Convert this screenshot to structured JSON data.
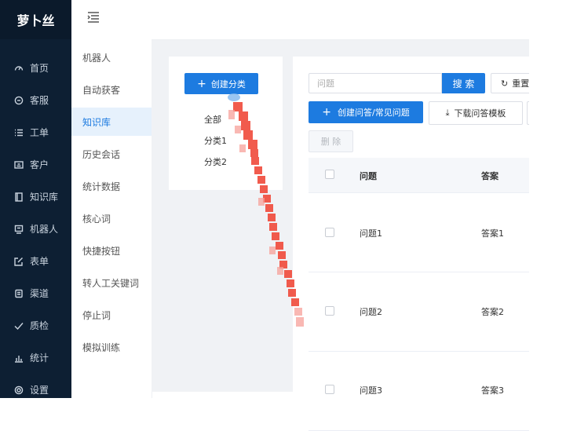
{
  "app": {
    "logo": "萝卜丝"
  },
  "sidebar": {
    "items": [
      {
        "label": "首页",
        "icon": "dashboard-icon"
      },
      {
        "label": "客服",
        "icon": "headset-icon"
      },
      {
        "label": "工单",
        "icon": "list-icon"
      },
      {
        "label": "客户",
        "icon": "contact-card-icon"
      },
      {
        "label": "知识库",
        "icon": "book-icon"
      },
      {
        "label": "机器人",
        "icon": "robot-icon"
      },
      {
        "label": "表单",
        "icon": "edit-form-icon"
      },
      {
        "label": "渠道",
        "icon": "channel-icon"
      },
      {
        "label": "质检",
        "icon": "check-icon"
      },
      {
        "label": "统计",
        "icon": "bar-chart-icon"
      },
      {
        "label": "设置",
        "icon": "gear-icon"
      }
    ]
  },
  "submenu": {
    "items": [
      "机器人",
      "自动获客",
      "知识库",
      "历史会话",
      "统计数据",
      "核心词",
      "快捷按钮",
      "转人工关键词",
      "停止词",
      "模拟训练"
    ],
    "active": "知识库"
  },
  "categories": {
    "create_label": "创建分类",
    "items": [
      "全部",
      "分类1",
      "分类2"
    ]
  },
  "toolbar": {
    "search_placeholder": "问题",
    "search_label": "搜 索",
    "reset_label": "重置",
    "create_qa_label": "创建问答/常见问题",
    "download_label": "下载问答模板",
    "delete_label": "删 除"
  },
  "table": {
    "headers": {
      "question": "问题",
      "answer": "答案"
    },
    "rows": [
      {
        "question": "问题1",
        "answer": "答案1"
      },
      {
        "question": "问题2",
        "answer": "答案2"
      },
      {
        "question": "问题3",
        "answer": "答案3"
      }
    ]
  },
  "colors": {
    "accent": "#1d7be0",
    "sidebar": "#0d1f33",
    "annotation": "#f04a3a"
  }
}
